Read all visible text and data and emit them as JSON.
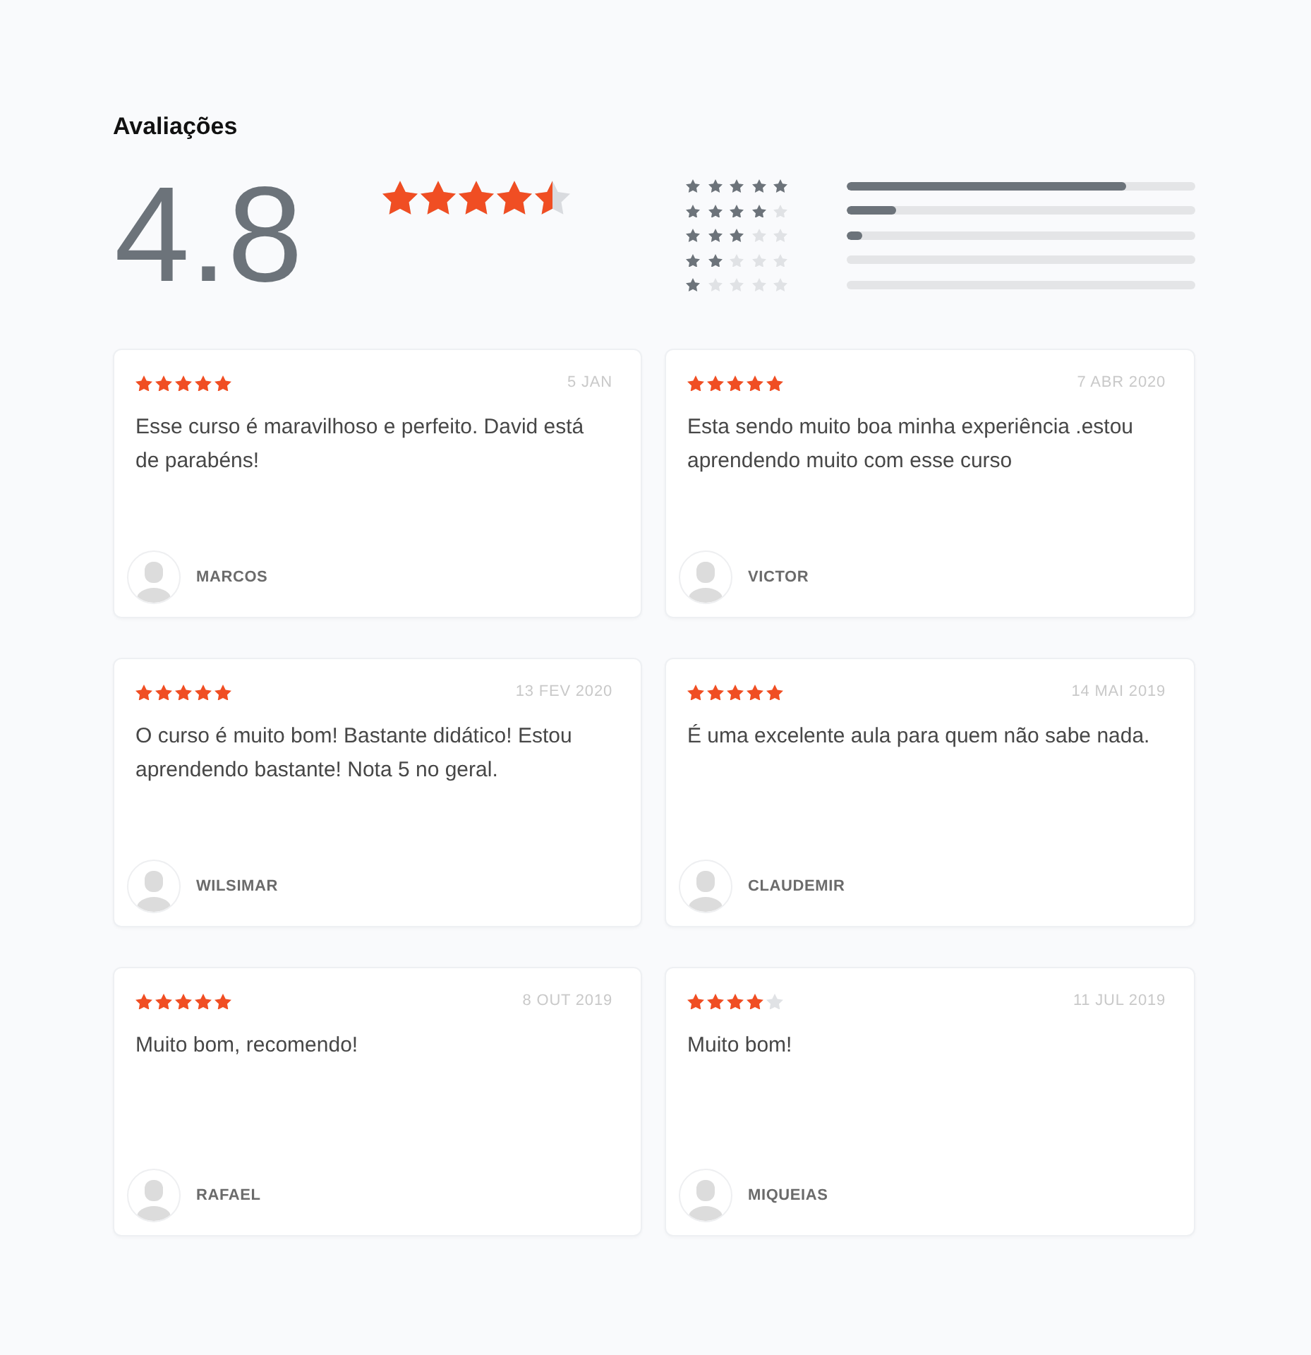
{
  "section": {
    "title": "Avaliações"
  },
  "summary": {
    "score": "4.8",
    "stars": 4.5
  },
  "distribution": [
    {
      "stars": 5,
      "level": 0.8
    },
    {
      "stars": 4,
      "level": 0.14
    },
    {
      "stars": 3,
      "level": 0.045
    },
    {
      "stars": 2,
      "level": 0
    },
    {
      "stars": 1,
      "level": 0
    }
  ],
  "reviews": [
    {
      "stars": 5,
      "date": "5 JAN",
      "text": "Esse curso é maravilhoso e perfeito. David está de parabéns!",
      "author": "MARCOS"
    },
    {
      "stars": 5,
      "date": "7 ABR 2020",
      "text": "Esta sendo muito boa minha experiência .estou aprendendo muito com esse curso",
      "author": "VICTOR"
    },
    {
      "stars": 5,
      "date": "13 FEV 2020",
      "text": "O curso é muito bom! Bastante didático! Estou aprendendo bastante! Nota 5 no geral.",
      "author": "WILSIMAR"
    },
    {
      "stars": 5,
      "date": "14 MAI 2019",
      "text": "É uma excelente aula para quem não sabe nada.",
      "author": "CLAUDEMIR"
    },
    {
      "stars": 5,
      "date": "8 OUT 2019",
      "text": "Muito bom, recomendo!",
      "author": "RAFAEL"
    },
    {
      "stars": 4,
      "date": "11 JUL 2019",
      "text": "Muito bom!",
      "author": "MIQUEIAS"
    }
  ]
}
